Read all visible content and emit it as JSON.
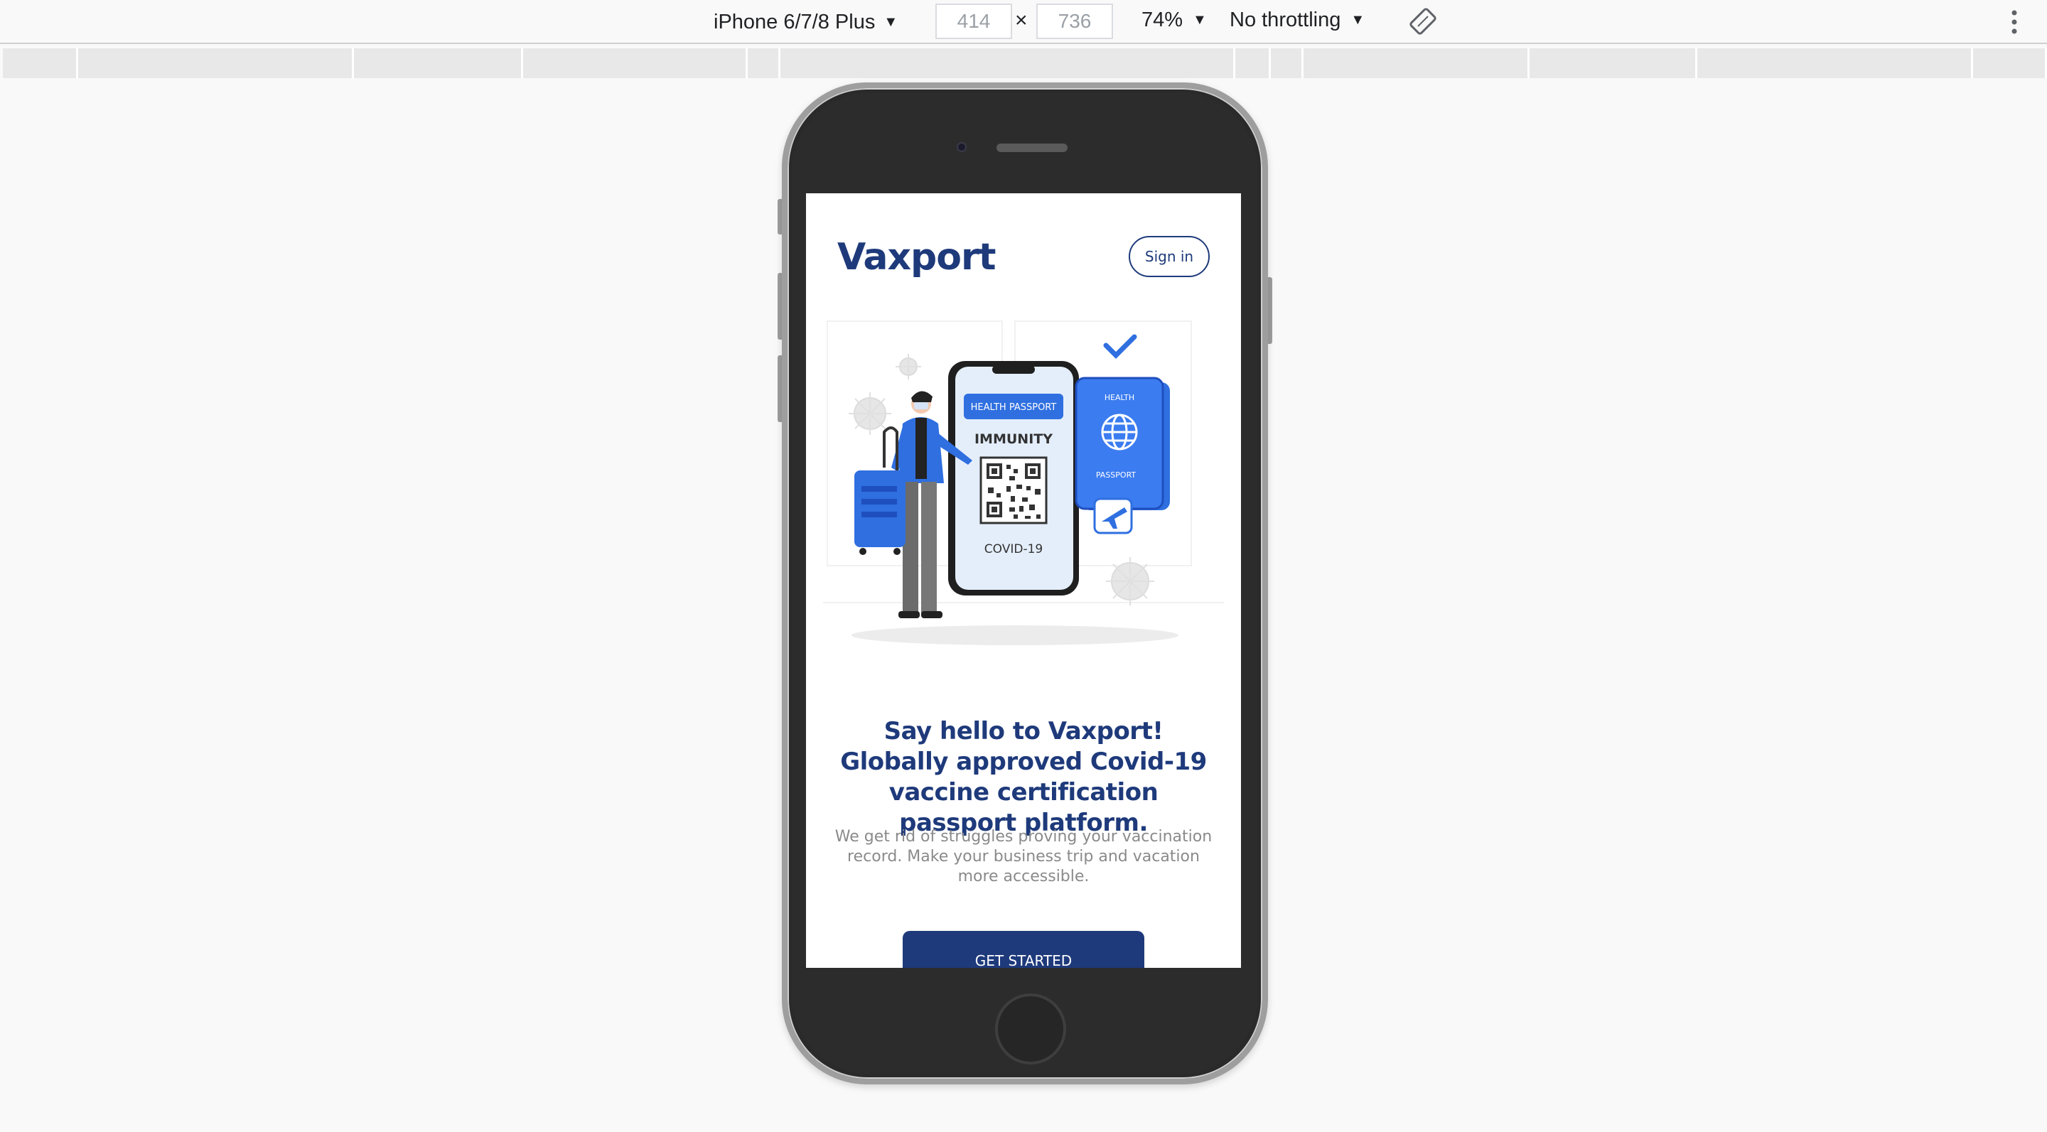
{
  "devtools": {
    "device": "iPhone 6/7/8 Plus",
    "width": "414",
    "height": "736",
    "times": "×",
    "zoom": "74%",
    "throttling": "No throttling",
    "caret": "▼"
  },
  "page": {
    "brand": "Vaxport",
    "signin_label": "Sign in",
    "illustration": {
      "health_passport": "HEALTH PASSPORT",
      "immunity": "IMMUNITY",
      "covid": "COVID-19",
      "book_top": "HEALTH",
      "book_bottom": "PASSPORT"
    },
    "headline": "Say hello to Vaxport! Globally approved Covid-19 vaccine certification passport platform.",
    "subtext": "We get rid of struggles proving your vaccination record. Make your business trip and vacation more accessible.",
    "cta_label": "GET STARTED"
  },
  "colors": {
    "brand": "#1e3a7b",
    "accent": "#2f6fe0",
    "subtext": "#8a8a8a"
  }
}
